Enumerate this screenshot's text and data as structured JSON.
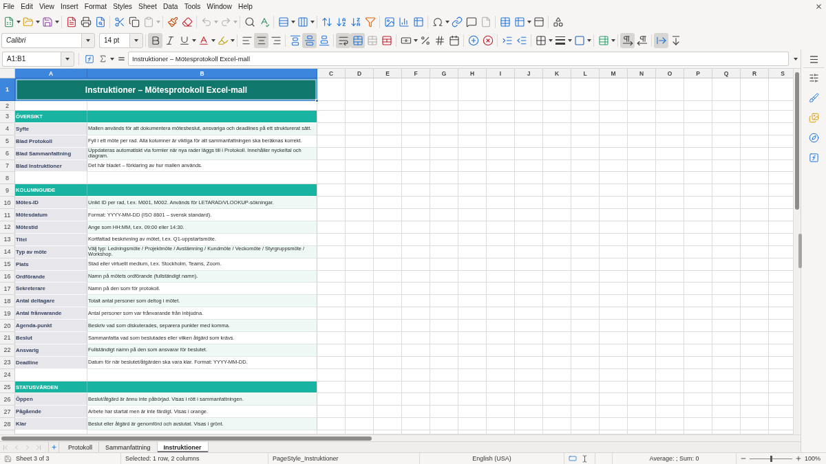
{
  "menu_bar": [
    "File",
    "Edit",
    "View",
    "Insert",
    "Format",
    "Styles",
    "Sheet",
    "Data",
    "Tools",
    "Window",
    "Help"
  ],
  "standard_toolbar": {
    "disabled": {
      "paste": true,
      "undo": true,
      "redo": true,
      "header_footer": true
    }
  },
  "formatting_toolbar": {
    "font_name": "Calibri",
    "font_size": "14 pt",
    "toggles": {
      "bold": true,
      "italic": false,
      "underline": false,
      "align_left": false,
      "align_center": true,
      "align_right": false,
      "align_top": false,
      "align_middle": true,
      "align_bottom": false,
      "wrap_text": true,
      "merge_and_center": true,
      "left_to_right": true,
      "right_to_left": false,
      "text_left_to_right": true,
      "text_top_to_bottom": false
    },
    "disabled": {
      "merge_cells": true
    }
  },
  "formula_bar": {
    "name_box": "A1:B1",
    "formula": "Instruktioner – Mötesprotokoll Excel-mall"
  },
  "sheet": {
    "columns": [
      {
        "label": "A",
        "selected": true
      },
      {
        "label": "B",
        "selected": true
      },
      {
        "label": "C",
        "selected": false
      },
      {
        "label": "D",
        "selected": false
      },
      {
        "label": "E",
        "selected": false
      },
      {
        "label": "F",
        "selected": false
      },
      {
        "label": "G",
        "selected": false
      },
      {
        "label": "H",
        "selected": false
      },
      {
        "label": "I",
        "selected": false
      },
      {
        "label": "J",
        "selected": false
      },
      {
        "label": "K",
        "selected": false
      },
      {
        "label": "L",
        "selected": false
      },
      {
        "label": "M",
        "selected": false
      },
      {
        "label": "N",
        "selected": false
      },
      {
        "label": "O",
        "selected": false
      },
      {
        "label": "P",
        "selected": false
      },
      {
        "label": "Q",
        "selected": false
      },
      {
        "label": "R",
        "selected": false
      },
      {
        "label": "S",
        "selected": false
      }
    ],
    "rows": [
      {
        "number": "1",
        "selected": true,
        "kind": "title",
        "text": "Instruktioner – Mötesprotokoll Excel-mall"
      },
      {
        "number": "2",
        "selected": false,
        "kind": "spacer"
      },
      {
        "number": "3",
        "selected": false,
        "kind": "section",
        "label": "ÖVERSIKT"
      },
      {
        "number": "4",
        "selected": false,
        "kind": "item",
        "label": "Syfte",
        "description": "Mallen används för att dokumentera mötesbeslut, ansvariga och deadlines på ett strukturerat sätt."
      },
      {
        "number": "5",
        "selected": false,
        "kind": "item",
        "label": "Blad Protokoll",
        "description": "Fyll i ett möte per rad. Alla kolumner är viktiga för att sammanfattningen ska beräknas korrekt."
      },
      {
        "number": "6",
        "selected": false,
        "kind": "item",
        "label": "Blad Sammanfattning",
        "description": "Uppdateras automatiskt via formler när nya rader läggs till i Protokoll. Innehåller nyckeltal och diagram."
      },
      {
        "number": "7",
        "selected": false,
        "kind": "item",
        "label": "Blad Instruktioner",
        "description": "Det här bladet – förklaring av hur mallen används."
      },
      {
        "number": "8",
        "selected": false,
        "kind": "blank"
      },
      {
        "number": "9",
        "selected": false,
        "kind": "section",
        "label": "KOLUMNGUIDE"
      },
      {
        "number": "10",
        "selected": false,
        "kind": "item",
        "label": "Mötes-ID",
        "description": "Unikt ID per rad, t.ex. M001, M002. Används för LETARAD/VLOOKUP-sökningar."
      },
      {
        "number": "11",
        "selected": false,
        "kind": "item",
        "label": "Mötesdatum",
        "description": "Format: YYYY-MM-DD (ISO 8601 – svensk standard)."
      },
      {
        "number": "12",
        "selected": false,
        "kind": "item",
        "label": "Mötestid",
        "description": "Ange som HH:MM, t.ex. 09:00 eller 14:30."
      },
      {
        "number": "13",
        "selected": false,
        "kind": "item",
        "label": "Titel",
        "description": "Kortfattad beskrivning av mötet, t.ex. Q1-uppstartsmöte."
      },
      {
        "number": "14",
        "selected": false,
        "kind": "item",
        "label": "Typ av möte",
        "description": "Välj typ: Ledningsmöte / Projektmöte / Avstämning / Kundmöte / Veckomöte / Styrgruppsmöte / Workshop."
      },
      {
        "number": "15",
        "selected": false,
        "kind": "item",
        "label": "Plats",
        "description": "Stad eller virtuellt medium, t.ex. Stockholm, Teams, Zoom."
      },
      {
        "number": "16",
        "selected": false,
        "kind": "item",
        "label": "Ordförande",
        "description": "Namn på mötets ordförande (fullständigt namn)."
      },
      {
        "number": "17",
        "selected": false,
        "kind": "item",
        "label": "Sekreterare",
        "description": "Namn på den som för protokoll."
      },
      {
        "number": "18",
        "selected": false,
        "kind": "item",
        "label": "Antal deltagare",
        "description": "Totalt antal personer som deltog i mötet."
      },
      {
        "number": "19",
        "selected": false,
        "kind": "item",
        "label": "Antal frånvarande",
        "description": "Antal personer som var frånvarande från inbjudna."
      },
      {
        "number": "20",
        "selected": false,
        "kind": "item",
        "label": "Agenda-punkt",
        "description": "Beskriv vad som diskuterades, separera punkter med komma."
      },
      {
        "number": "21",
        "selected": false,
        "kind": "item",
        "label": "Beslut",
        "description": "Sammanfatta vad som beslutades eller vilken åtgärd som krävs."
      },
      {
        "number": "22",
        "selected": false,
        "kind": "item",
        "label": "Ansvarig",
        "description": "Fullständigt namn på den som ansvarar för beslutet."
      },
      {
        "number": "23",
        "selected": false,
        "kind": "item",
        "label": "Deadline",
        "description": "Datum för när beslutet/åtgärden ska vara klar. Format: YYYY-MM-DD."
      },
      {
        "number": "24",
        "selected": false,
        "kind": "blank"
      },
      {
        "number": "25",
        "selected": false,
        "kind": "section",
        "label": "STATUSVÄRDEN"
      },
      {
        "number": "26",
        "selected": false,
        "kind": "item",
        "label": "Öppen",
        "description": "Beslut/åtgärd är ännu inte påbörjad. Visas i rött i sammanfattningen."
      },
      {
        "number": "27",
        "selected": false,
        "kind": "item",
        "label": "Pågående",
        "description": "Arbete har startat men är inte färdigt. Visas i orange."
      },
      {
        "number": "28",
        "selected": false,
        "kind": "item",
        "label": "Klar",
        "description": "Beslut eller åtgärd är genomförd och avslutat. Visas i grönt."
      }
    ]
  },
  "sheet_tabs": {
    "navigation_disabled": true,
    "tabs": [
      {
        "label": "Protokoll",
        "selected": false
      },
      {
        "label": "Sammanfattning",
        "selected": false
      },
      {
        "label": "Instruktioner",
        "selected": true
      }
    ]
  },
  "status_bar": {
    "sheet_position": "Sheet 3 of 3",
    "selection": "Selected: 1 row, 2 columns",
    "page_style": "PageStyle_Instruktioner",
    "language": "English (USA)",
    "sum": "Average: ; Sum: 0",
    "zoom": {
      "level": 0.5,
      "reading": "100%"
    }
  }
}
